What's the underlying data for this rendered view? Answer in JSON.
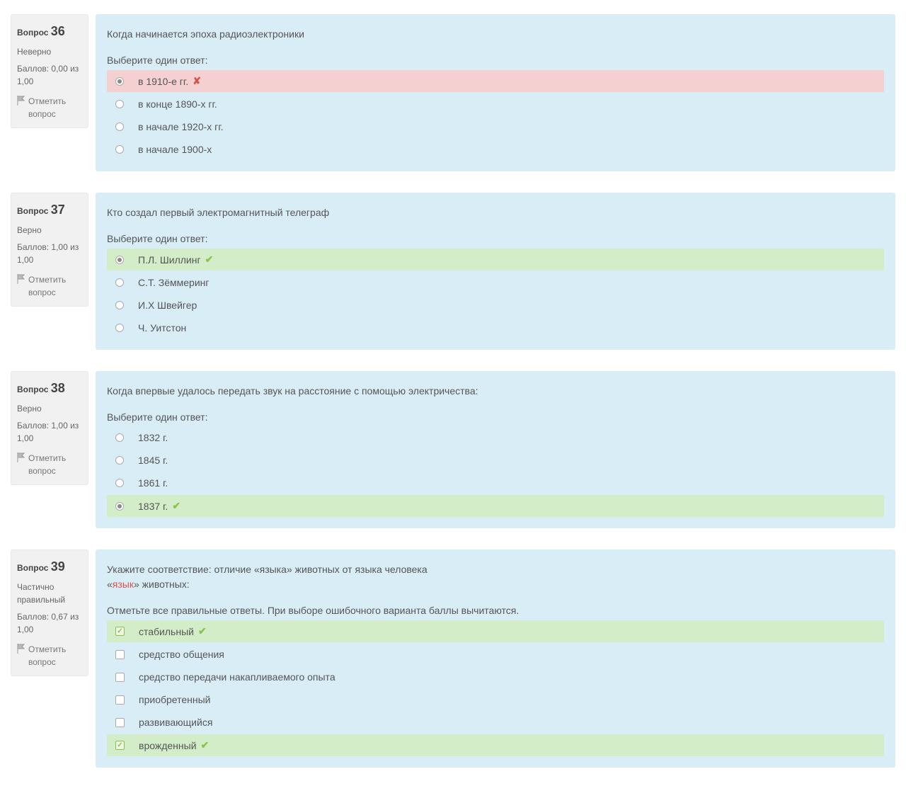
{
  "common": {
    "question_label": "Вопрос",
    "flag_label": "Отметить вопрос"
  },
  "questions": [
    {
      "number": "36",
      "state": "Неверно",
      "grade": "Баллов: 0,00 из 1,00",
      "text": "Когда начинается эпоха радиоэлектроники",
      "prompt": "Выберите один ответ:",
      "type": "radio",
      "options": [
        {
          "label": "в 1910-е гг.",
          "selected": true,
          "result": "incorrect"
        },
        {
          "label": "в конце 1890-х гг.",
          "selected": false,
          "result": ""
        },
        {
          "label": "в начале 1920-х гг.",
          "selected": false,
          "result": ""
        },
        {
          "label": "в начале 1900-х",
          "selected": false,
          "result": ""
        }
      ]
    },
    {
      "number": "37",
      "state": "Верно",
      "grade": "Баллов: 1,00 из 1,00",
      "text": "Кто создал первый электромагнитный телеграф",
      "prompt": "Выберите один ответ:",
      "type": "radio",
      "options": [
        {
          "label": "П.Л. Шиллинг",
          "selected": true,
          "result": "correct"
        },
        {
          "label": "С.Т. Зёммеринг",
          "selected": false,
          "result": ""
        },
        {
          "label": "И.Х Швейгер",
          "selected": false,
          "result": ""
        },
        {
          "label": "Ч. Уитстон",
          "selected": false,
          "result": ""
        }
      ]
    },
    {
      "number": "38",
      "state": "Верно",
      "grade": "Баллов: 1,00 из 1,00",
      "text": "Когда впервые удалось передать звук на расстояние с помощью электричества:",
      "prompt": "Выберите один ответ:",
      "type": "radio",
      "options": [
        {
          "label": "1832 г.",
          "selected": false,
          "result": ""
        },
        {
          "label": "1845 г.",
          "selected": false,
          "result": ""
        },
        {
          "label": "1861 г.",
          "selected": false,
          "result": ""
        },
        {
          "label": "1837 г.",
          "selected": true,
          "result": "correct"
        }
      ]
    },
    {
      "number": "39",
      "state": "Частично правильный",
      "grade": "Баллов: 0,67 из 1,00",
      "text_pre": "Укажите соответствие: отличие «языка»  животных от языка человека",
      "text_highlight_pre": "«",
      "text_highlight": "язык",
      "text_highlight_post": "» животных:",
      "prompt": "Отметьте все правильные ответы. При выборе ошибочного варианта баллы вычитаются.",
      "type": "checkbox",
      "options": [
        {
          "label": "стабильный",
          "selected": true,
          "result": "correct"
        },
        {
          "label": "средство общения",
          "selected": false,
          "result": ""
        },
        {
          "label": "средство передачи накапливаемого опыта",
          "selected": false,
          "result": ""
        },
        {
          "label": "приобретенный",
          "selected": false,
          "result": ""
        },
        {
          "label": "развивающийся",
          "selected": false,
          "result": ""
        },
        {
          "label": "врожденный",
          "selected": true,
          "result": "correct"
        }
      ]
    }
  ]
}
